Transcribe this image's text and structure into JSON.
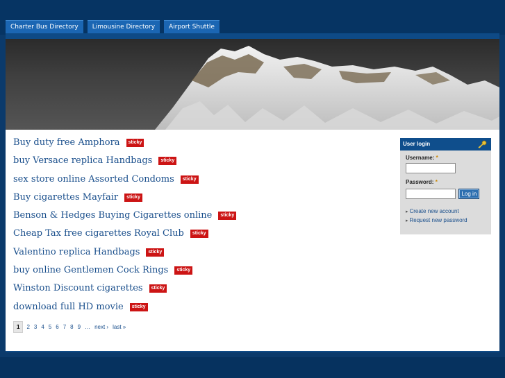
{
  "nav": {
    "tabs": [
      "Charter Bus Directory",
      "Limousine Directory",
      "Airport Shuttle"
    ]
  },
  "nodes": [
    {
      "title": "Buy duty free Amphora",
      "badge": "sticky"
    },
    {
      "title": "buy Versace replica Handbags",
      "badge": "sticky"
    },
    {
      "title": "sex store online Assorted Condoms",
      "badge": "sticky"
    },
    {
      "title": "Buy cigarettes Mayfair",
      "badge": "sticky"
    },
    {
      "title": "Benson & Hedges Buying Cigarettes online",
      "badge": "sticky"
    },
    {
      "title": "Cheap Tax free cigarettes Royal Club",
      "badge": "sticky"
    },
    {
      "title": "Valentino replica Handbags",
      "badge": "sticky"
    },
    {
      "title": "buy online Gentlemen Cock Rings",
      "badge": "sticky"
    },
    {
      "title": "Winston Discount cigarettes",
      "badge": "sticky"
    },
    {
      "title": "download full HD movie",
      "badge": "sticky"
    }
  ],
  "pager": {
    "current": "1",
    "pages": [
      "2",
      "3",
      "4",
      "5",
      "6",
      "7",
      "8",
      "9"
    ],
    "ellipsis": "…",
    "next": "next ›",
    "last": "last »"
  },
  "login": {
    "title": "User login",
    "username_label": "Username:",
    "password_label": "Password:",
    "required_mark": "*",
    "button": "Log in",
    "create_account": "Create new account",
    "request_password": "Request new password"
  },
  "colors": {
    "background": "#0b3a6b",
    "tab": "#1b66b3",
    "link": "#1a4f8c",
    "sticky_badge": "#cc1414",
    "login_header": "#0f4e8c"
  }
}
